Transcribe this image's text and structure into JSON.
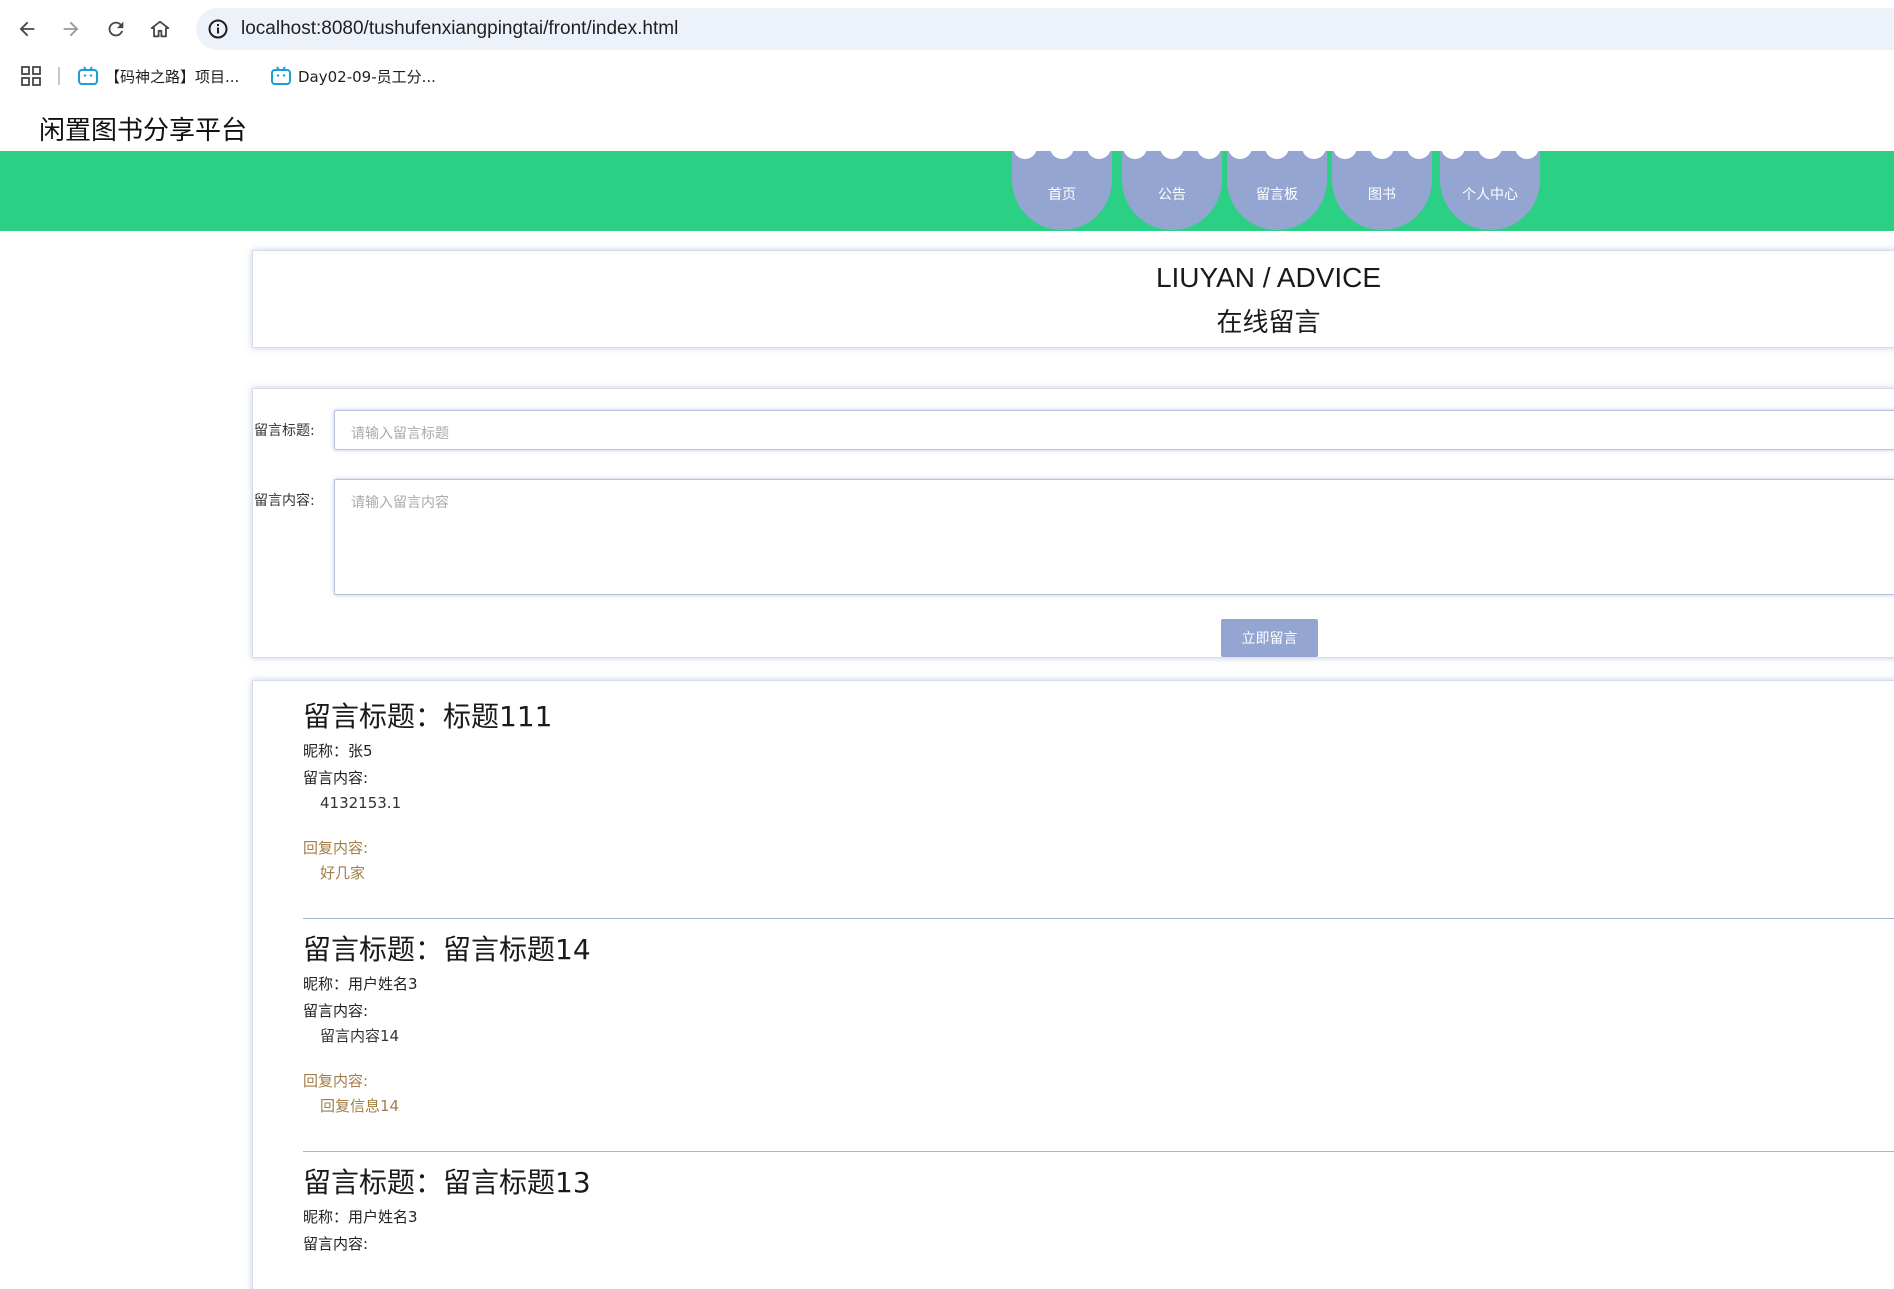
{
  "browser": {
    "url": "localhost:8080/tushufenxiangpingtai/front/index.html",
    "bookmarks": [
      {
        "label": "【码神之路】项目..."
      },
      {
        "label": "Day02-09-员工分..."
      }
    ]
  },
  "site": {
    "title": "闲置图书分享平台",
    "nav": [
      {
        "label": "首页"
      },
      {
        "label": "公告"
      },
      {
        "label": "留言板"
      },
      {
        "label": "图书"
      },
      {
        "label": "个人中心"
      }
    ]
  },
  "page_header": {
    "title_en": "LIUYAN / ADVICE",
    "title_cn": "在线留言"
  },
  "form": {
    "title_label": "留言标题:",
    "title_placeholder": "请输入留言标题",
    "content_label": "留言内容:",
    "content_placeholder": "请输入留言内容",
    "submit_label": "立即留言"
  },
  "messages": [
    {
      "title": "留言标题：标题111",
      "nickname": "昵称：张5",
      "content_label": "留言内容:",
      "content": "4132153.1",
      "reply_label": "回复内容:",
      "reply": "好几家"
    },
    {
      "title": "留言标题：留言标题14",
      "nickname": "昵称：用户姓名3",
      "content_label": "留言内容:",
      "content": "留言内容14",
      "reply_label": "回复内容:",
      "reply": "回复信息14"
    },
    {
      "title": "留言标题：留言标题13",
      "nickname": "昵称：用户姓名3",
      "content_label": "留言内容:"
    }
  ],
  "colors": {
    "band": "#2bd085",
    "nav_bubble": "#93a5d0",
    "reply": "#a17e4a"
  }
}
